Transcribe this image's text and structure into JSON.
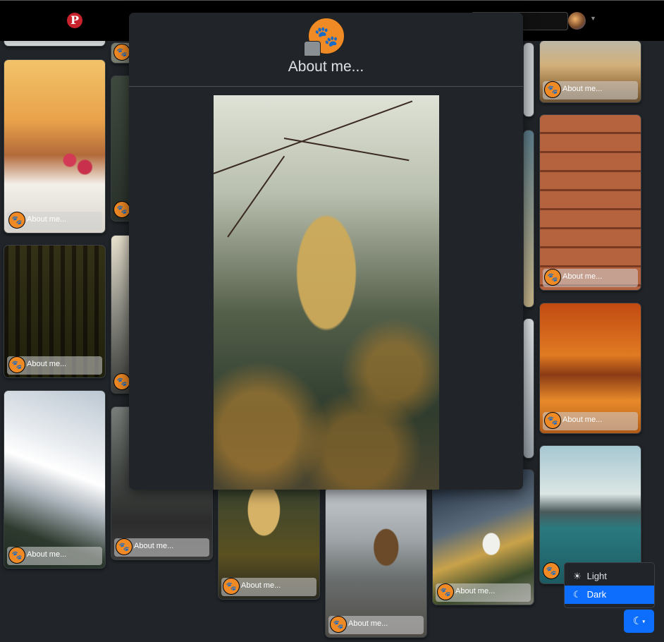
{
  "header": {
    "logo_glyph": "P",
    "logo_icon": "pinterest-icon",
    "user_avatar": "avatar"
  },
  "modal": {
    "title": "About me...",
    "icon": "paw-icon"
  },
  "cards": [
    {
      "caption": "About me..."
    },
    {
      "caption": "About me..."
    },
    {
      "caption": "About me..."
    },
    {
      "caption": "About me..."
    },
    {
      "caption": "About me..."
    },
    {
      "caption": "About me..."
    },
    {
      "caption": "About me..."
    },
    {
      "caption": "About me..."
    },
    {
      "caption": "About me..."
    },
    {
      "caption": "About me..."
    },
    {
      "caption": "About me..."
    },
    {
      "caption": "About me..."
    },
    {
      "caption": "About me..."
    }
  ],
  "theme_menu": {
    "options": [
      {
        "label": "Light",
        "icon": "sun-icon",
        "glyph": "☀"
      },
      {
        "label": "Dark",
        "icon": "moon-icon",
        "glyph": "☾"
      }
    ],
    "selected": "Dark",
    "toggle_glyph": "☾",
    "caret_glyph": "▾"
  },
  "colors": {
    "accent": "#0d6efd",
    "background": "#212529",
    "paw": "#f08a24",
    "logo": "#c8232c"
  }
}
